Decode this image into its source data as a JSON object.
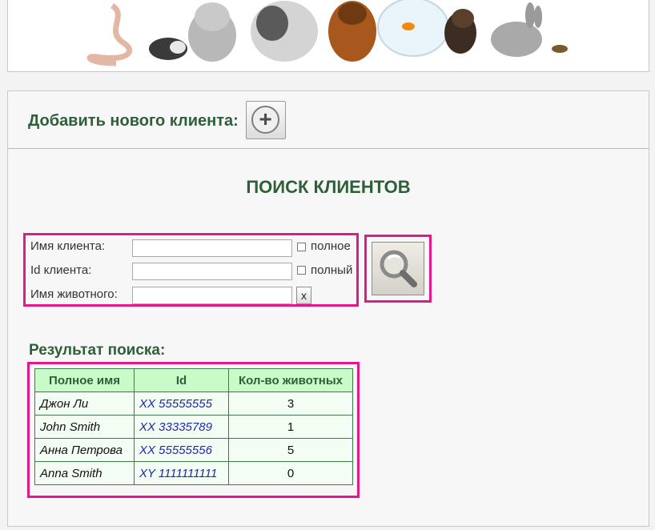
{
  "add_client": {
    "label": "Добавить нового клиента:",
    "button_icon": "plus-icon"
  },
  "search": {
    "title": "ПОИСК КЛИЕНТОВ",
    "client_name": {
      "label": "Имя клиента:",
      "value": "",
      "full_label": "полное",
      "checked": false
    },
    "client_id": {
      "label": "Id клиента:",
      "value": "",
      "full_label": "полный",
      "checked": false
    },
    "animal_name": {
      "label": "Имя животного:",
      "value": "",
      "clear_label": "x"
    },
    "button_icon": "magnifier-icon"
  },
  "results": {
    "label": "Результат поиска:",
    "columns": [
      "Полное имя",
      "Id",
      "Кол-во животных"
    ],
    "rows": [
      {
        "name": "Джон Ли",
        "id": "XX 55555555",
        "count": "3"
      },
      {
        "name": "John Smith",
        "id": "XX 33335789",
        "count": "1"
      },
      {
        "name": "Анна Петрова",
        "id": "XX 55555556",
        "count": "5"
      },
      {
        "name": "Anna Smith",
        "id": "XY 1111111111",
        "count": "0"
      }
    ]
  },
  "colors": {
    "accent_green": "#2f5f39",
    "highlight_frame": "#e0198c",
    "table_header": "#c9fbc9",
    "link_blue": "#1f2aa8"
  }
}
